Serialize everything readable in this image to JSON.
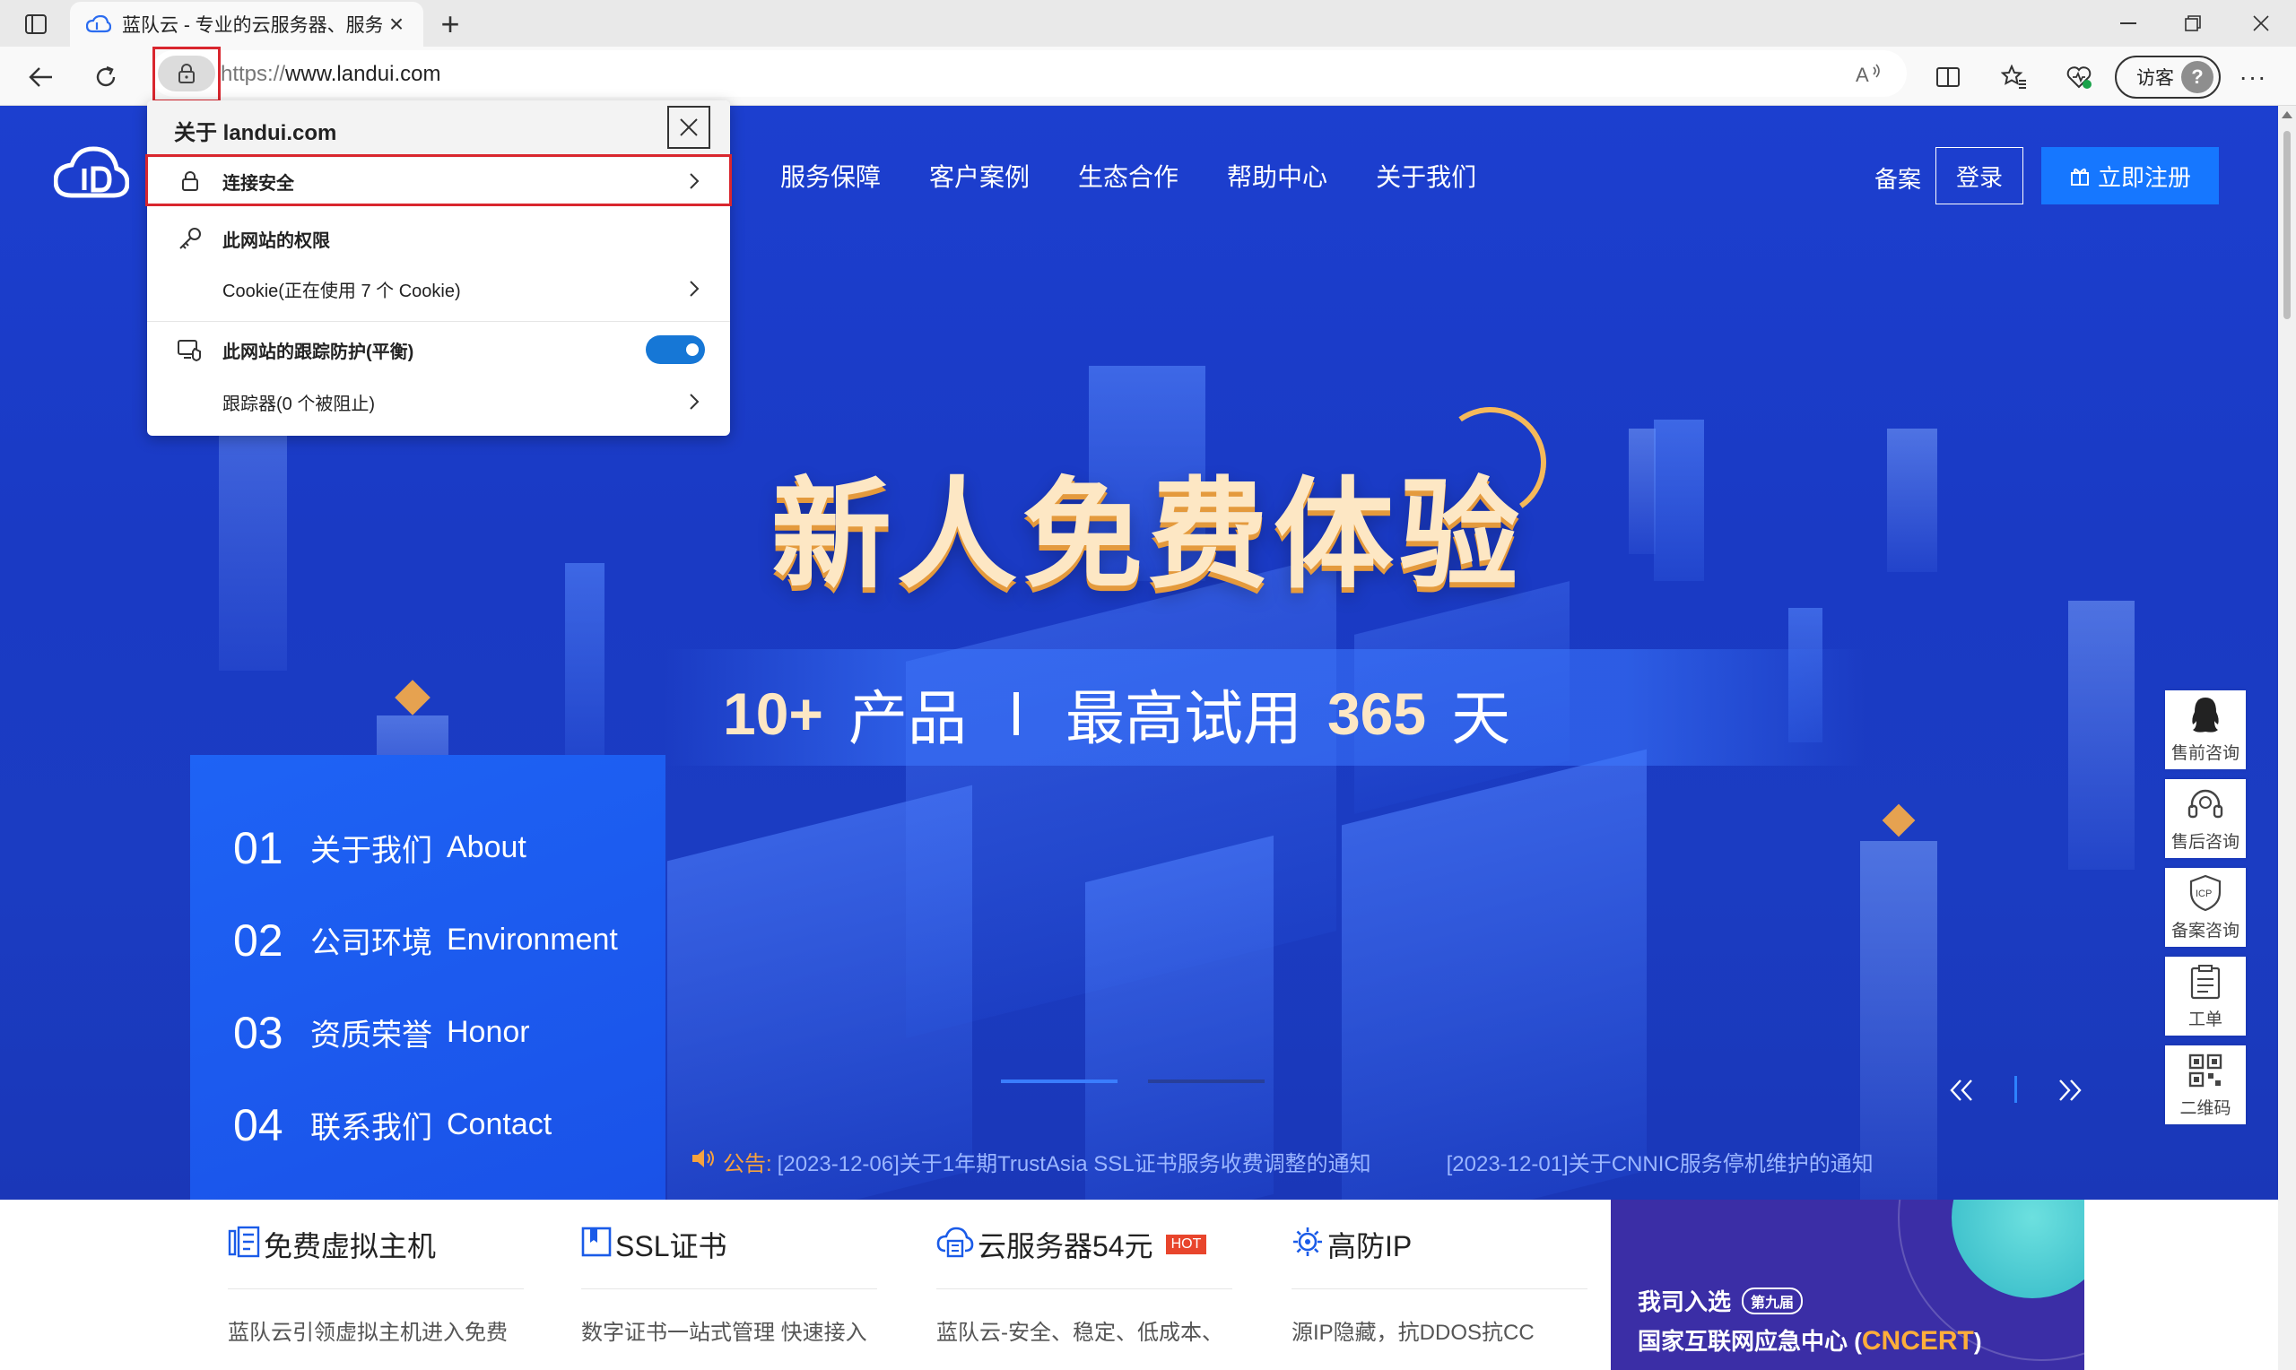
{
  "browser": {
    "tab_title": "蓝队云 - 专业的云服务器、服务器",
    "url_protocol": "https://",
    "url_host": "www.landui.com",
    "guest_label": "访客",
    "aa_label": "A⁾"
  },
  "site": {
    "nav": [
      "服务保障",
      "客户案例",
      "生态合作",
      "帮助中心",
      "关于我们"
    ],
    "beian": "备案",
    "login": "登录",
    "register": "立即注册"
  },
  "hero": {
    "title": "新人免费体验",
    "sub_count": "10+",
    "sub_products": "产品",
    "sub_max": "最高试用",
    "sub_days_num": "365",
    "sub_days": "天"
  },
  "about": [
    {
      "idx": "01",
      "cn": "关于我们",
      "en": "About"
    },
    {
      "idx": "02",
      "cn": "公司环境",
      "en": "Environment"
    },
    {
      "idx": "03",
      "cn": "资质荣誉",
      "en": "Honor"
    },
    {
      "idx": "04",
      "cn": "联系我们",
      "en": "Contact"
    }
  ],
  "notice": {
    "label": "公告:",
    "items": [
      "[2023-12-06]关于1年期TrustAsia SSL证书服务收费调整的通知",
      "[2023-12-01]关于CNNIC服务停机维护的通知"
    ]
  },
  "float_sidebar": [
    {
      "label": "售前咨询",
      "icon": "qq-icon"
    },
    {
      "label": "售后咨询",
      "icon": "headset-icon"
    },
    {
      "label": "备案咨询",
      "icon": "icp-shield-icon"
    },
    {
      "label": "工单",
      "icon": "clipboard-icon"
    },
    {
      "label": "二维码",
      "icon": "qrcode-icon"
    }
  ],
  "features": [
    {
      "title": "免费虚拟主机",
      "desc": "蓝队云引领虚拟主机进入免费",
      "icon": "vhost-icon"
    },
    {
      "title": "SSL证书",
      "desc": "数字证书一站式管理 快速接入",
      "icon": "ssl-icon"
    },
    {
      "title": "云服务器54元",
      "desc": "蓝队云-安全、稳定、低成本、",
      "icon": "cloud-server-icon",
      "badge": "HOT"
    },
    {
      "title": "高防IP",
      "desc": "源IP隐藏，抗DDOS抗CC",
      "icon": "gear-shield-icon"
    }
  ],
  "promo": {
    "line1": "我司入选",
    "badge": "第九届",
    "line2_prefix": "国家互联网应急中心 (",
    "line2_highlight": "CNCERT",
    "line2_suffix": ")"
  },
  "popup": {
    "title": "关于 landui.com",
    "connection": "连接安全",
    "permissions": "此网站的权限",
    "cookies": "Cookie(正在使用 7 个 Cookie)",
    "tracking": "此网站的跟踪防护(平衡)",
    "trackers": "跟踪器(0 个被阻止)",
    "tracking_enabled": true
  },
  "colors": {
    "hero_blue": "#1c3fcf",
    "accent_blue": "#1677ff",
    "highlight_red": "#d9262e",
    "hot_red": "#e8452c",
    "notice_orange": "#f6a23e"
  }
}
